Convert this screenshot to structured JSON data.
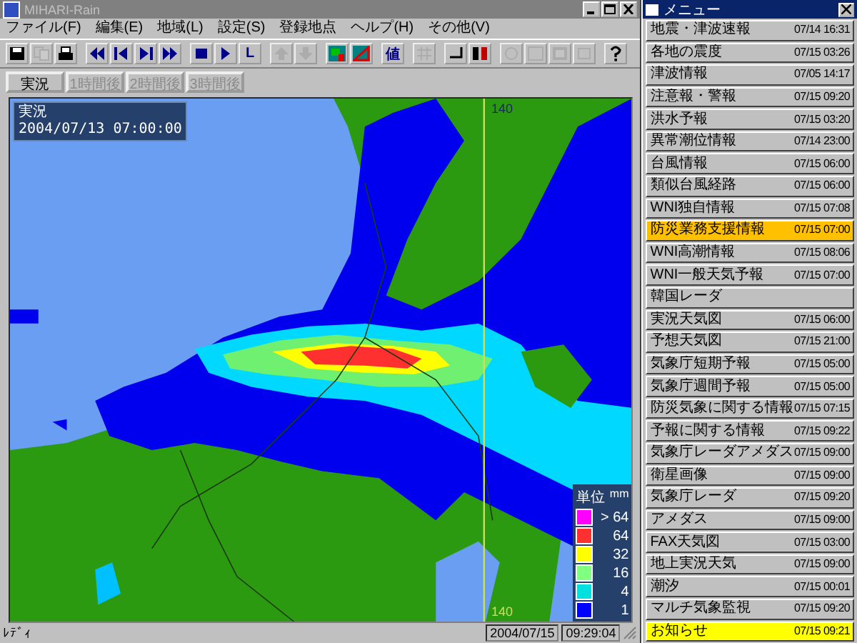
{
  "window": {
    "title": "MIHARI-Rain"
  },
  "menu_bar": [
    "ファイル(F)",
    "編集(E)",
    "地域(L)",
    "設定(S)",
    "登録地点",
    "ヘルプ(H)",
    "その他(V)"
  ],
  "toolbar": [
    {
      "disabled": false
    },
    {
      "disabled": true
    },
    {
      "disabled": false
    },
    {
      "disabled": false
    },
    {
      "disabled": false
    },
    {
      "disabled": false
    },
    {
      "disabled": false
    },
    {
      "disabled": false
    },
    {
      "disabled": false
    },
    {
      "label": "L",
      "disabled": false
    },
    {
      "disabled": true
    },
    {
      "disabled": true
    },
    {
      "disabled": false
    },
    {
      "disabled": false
    },
    {
      "label": "値",
      "disabled": false
    },
    {
      "disabled": true
    },
    {
      "disabled": false
    },
    {
      "disabled": false
    },
    {
      "disabled": true
    },
    {
      "disabled": true
    },
    {
      "disabled": true
    },
    {
      "disabled": true
    },
    {
      "disabled": false
    }
  ],
  "time_tabs": [
    {
      "label": "実況",
      "disabled": false
    },
    {
      "label": "1時間後",
      "disabled": true
    },
    {
      "label": "2時間後",
      "disabled": true
    },
    {
      "label": "3時間後",
      "disabled": true
    }
  ],
  "map": {
    "info_title": "実況",
    "info_time": "2004/07/13 07:00:00",
    "longitude_labels": [
      "140",
      "140"
    ],
    "legend": {
      "title": "単位",
      "unit": "mm",
      "items": [
        {
          "label": "> 64",
          "color": "#ff00ff"
        },
        {
          "label": "64",
          "color": "#ff3030"
        },
        {
          "label": "32",
          "color": "#ffff00"
        },
        {
          "label": "16",
          "color": "#80ff80"
        },
        {
          "label": "4",
          "color": "#00e0e0"
        },
        {
          "label": "1",
          "color": "#0000ff"
        }
      ]
    }
  },
  "status_bar": {
    "message": "ﾚﾃﾞｨ",
    "date": "2004/07/15",
    "time": "09:29:04"
  },
  "menu_panel": {
    "title": "メニュー",
    "items": [
      {
        "name": "地震・津波速報",
        "time": "07/14 16:31",
        "color": "#c0c0c0"
      },
      {
        "name": "各地の震度",
        "time": "07/15 03:26",
        "color": "#c0c0c0"
      },
      {
        "name": "津波情報",
        "time": "07/05 14:17",
        "color": "#c0c0c0"
      },
      {
        "name": "注意報・警報",
        "time": "07/15 09:20",
        "color": "#c0c0c0"
      },
      {
        "name": "洪水予報",
        "time": "07/15 03:20",
        "color": "#c0c0c0"
      },
      {
        "name": "異常潮位情報",
        "time": "07/14 23:00",
        "color": "#c0c0c0"
      },
      {
        "name": "台風情報",
        "time": "07/15 06:00",
        "color": "#c0c0c0"
      },
      {
        "name": "類似台風経路",
        "time": "07/15 06:00",
        "color": "#c0c0c0"
      },
      {
        "name": "WNI独自情報",
        "time": "07/15 07:08",
        "color": "#c0c0c0"
      },
      {
        "name": "防災業務支援情報",
        "time": "07/15 07:00",
        "color": "#ffc000"
      },
      {
        "name": "WNI高潮情報",
        "time": "07/15 08:06",
        "color": "#c0c0c0"
      },
      {
        "name": "WNI一般天気予報",
        "time": "07/15 07:00",
        "color": "#c0c0c0"
      },
      {
        "name": "韓国レーダ",
        "color": "#c0c0c0"
      },
      {
        "name": "実況天気図",
        "time": "07/15 06:00",
        "color": "#c0c0c0"
      },
      {
        "name": "予想天気図",
        "time": "07/15 21:00",
        "color": "#c0c0c0"
      },
      {
        "name": "気象庁短期予報",
        "time": "07/15 05:00",
        "color": "#c0c0c0"
      },
      {
        "name": "気象庁週間予報",
        "time": "07/15 05:00",
        "color": "#c0c0c0"
      },
      {
        "name": "防災気象に関する情報",
        "time": "07/15 07:15",
        "color": "#c0c0c0"
      },
      {
        "name": "予報に関する情報",
        "time": "07/15 09:22",
        "color": "#c0c0c0"
      },
      {
        "name": "気象庁レーダアメダス",
        "time": "07/15 09:00",
        "color": "#c0c0c0"
      },
      {
        "name": "衛星画像",
        "time": "07/15 09:00",
        "color": "#c0c0c0"
      },
      {
        "name": "気象庁レーダ",
        "time": "07/15 09:20",
        "color": "#c0c0c0"
      },
      {
        "name": "アメダス",
        "time": "07/15 09:00",
        "color": "#c0c0c0"
      },
      {
        "name": "FAX天気図",
        "time": "07/15 03:00",
        "color": "#c0c0c0"
      },
      {
        "name": "地上実況天気",
        "time": "07/15 09:00",
        "color": "#c0c0c0"
      },
      {
        "name": "潮汐",
        "time": "07/15 00:01",
        "color": "#c0c0c0"
      },
      {
        "name": "マルチ気象監視",
        "time": "07/15 09:20",
        "color": "#c0c0c0"
      },
      {
        "name": "お知らせ",
        "time": "07/15 09:21",
        "color": "#ffff00"
      }
    ]
  }
}
